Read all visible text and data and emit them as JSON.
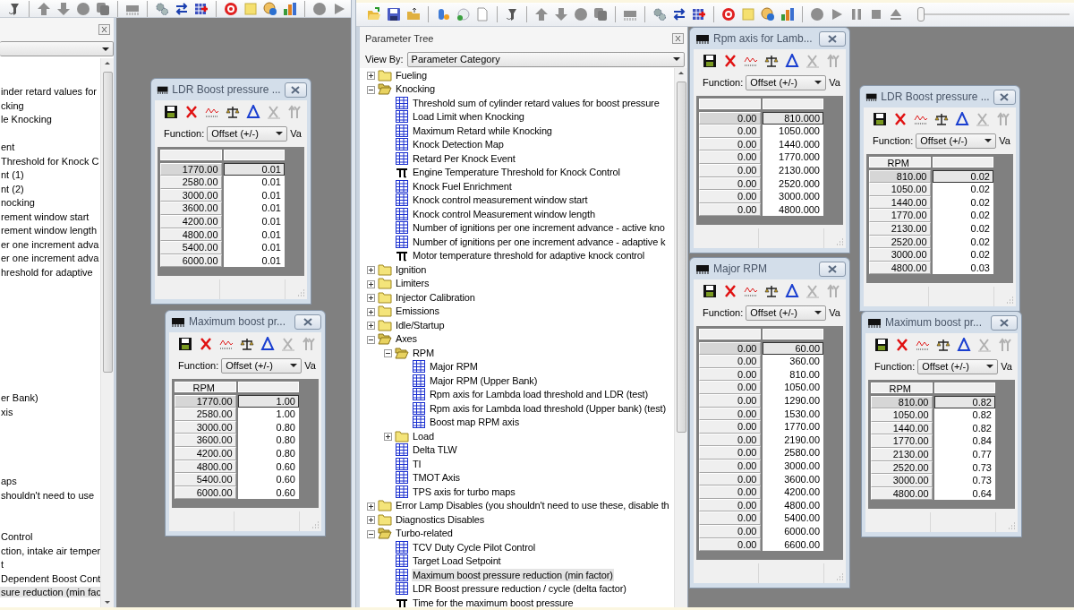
{
  "left_app": {
    "tree": {
      "sections": [
        {
          "items": [
            {
              "text": "inder retard values for",
              "selected": false
            },
            {
              "text": "cking",
              "selected": false
            },
            {
              "text": "le Knocking",
              "selected": false
            }
          ]
        },
        {
          "items": [
            {
              "text": "ent",
              "selected": false
            },
            {
              "text": "Threshold for Knock C",
              "selected": false
            },
            {
              "text": "nt (1)",
              "selected": false
            },
            {
              "text": "nt (2)",
              "selected": false
            },
            {
              "text": "nocking",
              "selected": false
            },
            {
              "text": "rement window start",
              "selected": false
            },
            {
              "text": "rement window length",
              "selected": false
            },
            {
              "text": "er one increment adva",
              "selected": false
            },
            {
              "text": "er one increment adva",
              "selected": false
            },
            {
              "text": "hreshold for adaptive",
              "selected": false
            }
          ]
        },
        {
          "items": [
            {
              "text": "er Bank)",
              "selected": false
            },
            {
              "text": "xis",
              "selected": false
            }
          ]
        },
        {
          "items": [
            {
              "text": "aps",
              "selected": false
            },
            {
              "text": "shouldn't need to use",
              "selected": false
            }
          ]
        },
        {
          "items": [
            {
              "text": "Control",
              "selected": false
            },
            {
              "text": "ction, intake air temper",
              "selected": false
            },
            {
              "text": "t",
              "selected": false
            },
            {
              "text": "Dependent Boost Cont",
              "selected": false
            },
            {
              "text": "sure reduction (min fac",
              "selected": true
            }
          ]
        }
      ]
    },
    "windows": [
      {
        "title": "LDR Boost pressure ...",
        "function_label": "Function:",
        "function_value": "Offset (+/-)",
        "value_label": "Va",
        "rows": [
          {
            "key": "1770.00",
            "value": "0.01",
            "selected": true
          },
          {
            "key": "2580.00",
            "value": "0.01",
            "selected": false
          },
          {
            "key": "3000.00",
            "value": "0.01",
            "selected": false
          },
          {
            "key": "3600.00",
            "value": "0.01",
            "selected": false
          },
          {
            "key": "4200.00",
            "value": "0.01",
            "selected": false
          },
          {
            "key": "4800.00",
            "value": "0.01",
            "selected": false
          },
          {
            "key": "5400.00",
            "value": "0.01",
            "selected": false
          },
          {
            "key": "6000.00",
            "value": "0.01",
            "selected": false
          }
        ]
      },
      {
        "title": "Maximum boost pr...",
        "function_label": "Function:",
        "function_value": "Offset (+/-)",
        "value_label": "Va",
        "row_header_title": "RPM",
        "rows": [
          {
            "key": "1770.00",
            "value": "1.00",
            "selected": true
          },
          {
            "key": "2580.00",
            "value": "1.00",
            "selected": false
          },
          {
            "key": "3000.00",
            "value": "0.80",
            "selected": false
          },
          {
            "key": "3600.00",
            "value": "0.80",
            "selected": false
          },
          {
            "key": "4200.00",
            "value": "0.80",
            "selected": false
          },
          {
            "key": "4800.00",
            "value": "0.60",
            "selected": false
          },
          {
            "key": "5400.00",
            "value": "0.60",
            "selected": false
          },
          {
            "key": "6000.00",
            "value": "0.60",
            "selected": false
          }
        ]
      }
    ]
  },
  "right_app": {
    "playback_slider": {
      "level": 0
    },
    "tree_panel": {
      "title": "Parameter Tree",
      "view_by_label": "View By:",
      "view_by_value": "Parameter Category",
      "items": [
        {
          "kind": "folder",
          "text": "Fueling",
          "expanded": false,
          "selected": false
        },
        {
          "kind": "folder",
          "text": "Knocking",
          "expanded": true,
          "selected": false,
          "children": [
            {
              "kind": "table",
              "text": "Threshold sum of cylinder retard values for boost pressure",
              "selected": false
            },
            {
              "kind": "table",
              "text": "Load Limit when Knocking",
              "selected": false
            },
            {
              "kind": "table",
              "text": "Maximum Retard while Knocking",
              "selected": false
            },
            {
              "kind": "table",
              "text": "Knock Detection Map",
              "selected": false
            },
            {
              "kind": "table",
              "text": "Retard Per Knock Event",
              "selected": false
            },
            {
              "kind": "constant",
              "text": "Engine Temperature Threshold for Knock Control",
              "selected": false
            },
            {
              "kind": "table",
              "text": "Knock Fuel Enrichment",
              "selected": false
            },
            {
              "kind": "table",
              "text": "Knock control measurement window start",
              "selected": false
            },
            {
              "kind": "table",
              "text": "Knock control Measurement window length",
              "selected": false
            },
            {
              "kind": "table",
              "text": "Number of ignitions per one increment advance - active kno",
              "selected": false
            },
            {
              "kind": "table",
              "text": "Number of ignitions per one increment advance - adaptive k",
              "selected": false
            },
            {
              "kind": "constant",
              "text": "Motor temperature threshold for adaptive knock control",
              "selected": false
            }
          ]
        },
        {
          "kind": "folder",
          "text": "Ignition",
          "expanded": false,
          "selected": false
        },
        {
          "kind": "folder",
          "text": "Limiters",
          "expanded": false,
          "selected": false
        },
        {
          "kind": "folder",
          "text": "Injector Calibration",
          "expanded": false,
          "selected": false
        },
        {
          "kind": "folder",
          "text": "Emissions",
          "expanded": false,
          "selected": false
        },
        {
          "kind": "folder",
          "text": "Idle/Startup",
          "expanded": false,
          "selected": false
        },
        {
          "kind": "folder",
          "text": "Axes",
          "expanded": true,
          "selected": false,
          "children": [
            {
              "kind": "folder",
              "text": "RPM",
              "expanded": true,
              "selected": false,
              "children": [
                {
                  "kind": "table",
                  "text": "Major RPM",
                  "selected": false
                },
                {
                  "kind": "table",
                  "text": "Major RPM (Upper Bank)",
                  "selected": false
                },
                {
                  "kind": "table",
                  "text": "Rpm axis for Lambda load threshold and LDR (test)",
                  "selected": false
                },
                {
                  "kind": "table",
                  "text": "Rpm axis for Lambda load threshold (Upper bank) (test)",
                  "selected": false
                },
                {
                  "kind": "table",
                  "text": "Boost map RPM axis",
                  "selected": false
                }
              ]
            },
            {
              "kind": "folder",
              "text": "Load",
              "expanded": false,
              "selected": false
            },
            {
              "kind": "table",
              "text": "Delta TLW",
              "selected": false
            },
            {
              "kind": "table",
              "text": "TI",
              "selected": false
            },
            {
              "kind": "table",
              "text": "TMOT Axis",
              "selected": false
            },
            {
              "kind": "table",
              "text": "TPS axis for turbo maps",
              "selected": false
            }
          ]
        },
        {
          "kind": "folder",
          "text": "Error Lamp Disables (you shouldn't need to use these, disable th",
          "expanded": false,
          "selected": false
        },
        {
          "kind": "folder",
          "text": "Diagnostics Disables",
          "expanded": false,
          "selected": false
        },
        {
          "kind": "folder",
          "text": "Turbo-related",
          "expanded": true,
          "selected": false,
          "children": [
            {
              "kind": "table",
              "text": "TCV Duty Cycle Pilot Control",
              "selected": false
            },
            {
              "kind": "table",
              "text": "Target Load Setpoint",
              "selected": false
            },
            {
              "kind": "table",
              "text": "Maximum boost pressure reduction (min factor)",
              "selected": true
            },
            {
              "kind": "table",
              "text": "LDR Boost pressure reduction / cycle (delta factor)",
              "selected": false
            },
            {
              "kind": "constant",
              "text": "Time for the maximum boost pressure",
              "selected": false
            }
          ]
        }
      ]
    },
    "windows": [
      {
        "title": "Rpm axis for Lamb...",
        "function_label": "Function:",
        "function_value": "Offset (+/-)",
        "value_label": "Va",
        "rows": [
          {
            "key": "0.00",
            "value": "810.000",
            "selected": true
          },
          {
            "key": "0.00",
            "value": "1050.000",
            "selected": false
          },
          {
            "key": "0.00",
            "value": "1440.000",
            "selected": false
          },
          {
            "key": "0.00",
            "value": "1770.000",
            "selected": false
          },
          {
            "key": "0.00",
            "value": "2130.000",
            "selected": false
          },
          {
            "key": "0.00",
            "value": "2520.000",
            "selected": false
          },
          {
            "key": "0.00",
            "value": "3000.000",
            "selected": false
          },
          {
            "key": "0.00",
            "value": "4800.000",
            "selected": false
          }
        ]
      },
      {
        "title": "LDR Boost pressure ...",
        "function_label": "Function:",
        "function_value": "Offset (+/-)",
        "value_label": "Va",
        "row_header_title": "RPM",
        "rows": [
          {
            "key": "810.00",
            "value": "0.02",
            "selected": true
          },
          {
            "key": "1050.00",
            "value": "0.02",
            "selected": false
          },
          {
            "key": "1440.00",
            "value": "0.02",
            "selected": false
          },
          {
            "key": "1770.00",
            "value": "0.02",
            "selected": false
          },
          {
            "key": "2130.00",
            "value": "0.02",
            "selected": false
          },
          {
            "key": "2520.00",
            "value": "0.02",
            "selected": false
          },
          {
            "key": "3000.00",
            "value": "0.02",
            "selected": false
          },
          {
            "key": "4800.00",
            "value": "0.03",
            "selected": false
          }
        ]
      },
      {
        "title": "Major RPM",
        "function_label": "Function:",
        "function_value": "Offset (+/-)",
        "value_label": "Va",
        "rows": [
          {
            "key": "0.00",
            "value": "60.00",
            "selected": true
          },
          {
            "key": "0.00",
            "value": "360.00",
            "selected": false
          },
          {
            "key": "0.00",
            "value": "810.00",
            "selected": false
          },
          {
            "key": "0.00",
            "value": "1050.00",
            "selected": false
          },
          {
            "key": "0.00",
            "value": "1290.00",
            "selected": false
          },
          {
            "key": "0.00",
            "value": "1530.00",
            "selected": false
          },
          {
            "key": "0.00",
            "value": "1770.00",
            "selected": false
          },
          {
            "key": "0.00",
            "value": "2190.00",
            "selected": false
          },
          {
            "key": "0.00",
            "value": "2580.00",
            "selected": false
          },
          {
            "key": "0.00",
            "value": "3000.00",
            "selected": false
          },
          {
            "key": "0.00",
            "value": "3600.00",
            "selected": false
          },
          {
            "key": "0.00",
            "value": "4200.00",
            "selected": false
          },
          {
            "key": "0.00",
            "value": "4800.00",
            "selected": false
          },
          {
            "key": "0.00",
            "value": "5400.00",
            "selected": false
          },
          {
            "key": "0.00",
            "value": "6000.00",
            "selected": false
          },
          {
            "key": "0.00",
            "value": "6600.00",
            "selected": false
          }
        ]
      },
      {
        "title": "Maximum boost pr...",
        "function_label": "Function:",
        "function_value": "Offset (+/-)",
        "value_label": "Va",
        "row_header_title": "RPM",
        "rows": [
          {
            "key": "810.00",
            "value": "0.82",
            "selected": true
          },
          {
            "key": "1050.00",
            "value": "0.82",
            "selected": false
          },
          {
            "key": "1440.00",
            "value": "0.82",
            "selected": false
          },
          {
            "key": "1770.00",
            "value": "0.84",
            "selected": false
          },
          {
            "key": "2130.00",
            "value": "0.77",
            "selected": false
          },
          {
            "key": "2520.00",
            "value": "0.73",
            "selected": false
          },
          {
            "key": "3000.00",
            "value": "0.73",
            "selected": false
          },
          {
            "key": "4800.00",
            "value": "0.64",
            "selected": false
          }
        ]
      }
    ]
  }
}
